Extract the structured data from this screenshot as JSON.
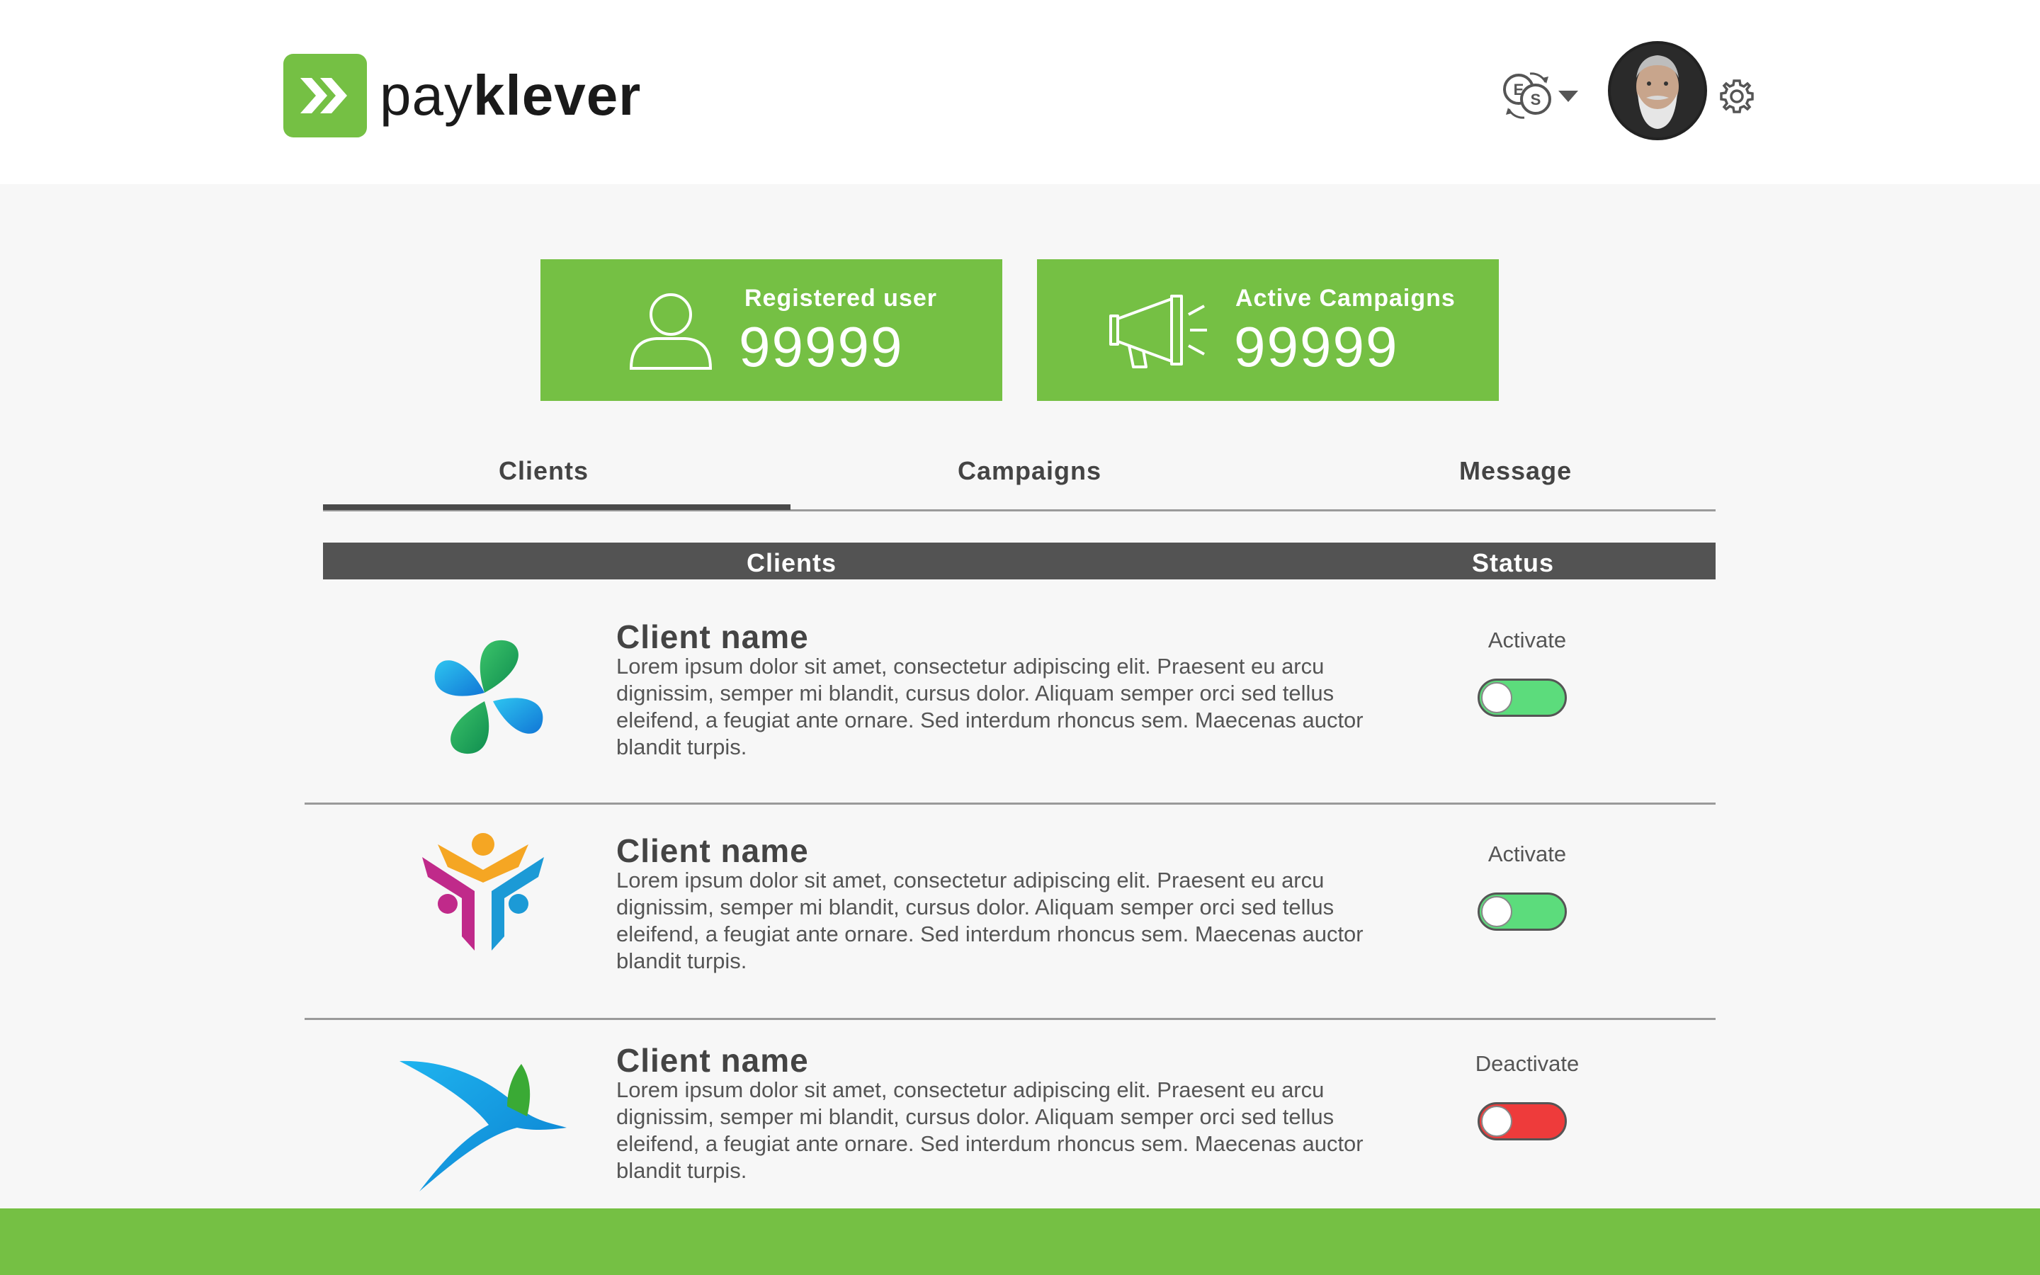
{
  "brand": {
    "name_light": "pay",
    "name_bold": "klever",
    "color": "#75c044"
  },
  "header": {
    "currency_icon": "currency-exchange-icon",
    "avatar_alt": "user avatar",
    "settings_icon": "gear-icon"
  },
  "stats": [
    {
      "label": "Registered user",
      "value": "99999",
      "icon": "user-icon"
    },
    {
      "label": "Active Campaigns",
      "value": "99999",
      "icon": "megaphone-icon"
    }
  ],
  "tabs": [
    {
      "label": "Clients",
      "active": true
    },
    {
      "label": "Campaigns",
      "active": false
    },
    {
      "label": "Message",
      "active": false
    }
  ],
  "table": {
    "headers": {
      "clients": "Clients",
      "status": "Status"
    },
    "rows": [
      {
        "name": "Client name",
        "description": "Lorem ipsum dolor sit amet, consectetur adipiscing elit. Praesent eu arcu dignissim, semper mi blandit, cursus dolor. Aliquam semper orci sed tellus eleifend, a feugiat ante ornare. Sed interdum rhoncus sem. Maecenas auctor blandit turpis.",
        "status": "Activate",
        "toggle": "on"
      },
      {
        "name": "Client name",
        "description": "Lorem ipsum dolor sit amet, consectetur adipiscing elit. Praesent eu arcu dignissim, semper mi blandit, cursus dolor. Aliquam semper orci sed tellus eleifend, a feugiat ante ornare. Sed interdum rhoncus sem. Maecenas auctor blandit turpis.",
        "status": "Activate",
        "toggle": "on"
      },
      {
        "name": "Client name",
        "description": "Lorem ipsum dolor sit amet, consectetur adipiscing elit. Praesent eu arcu dignissim, semper mi blandit, cursus dolor. Aliquam semper orci sed tellus eleifend, a feugiat ante ornare. Sed interdum rhoncus sem. Maecenas auctor blandit turpis.",
        "status": "Deactivate",
        "toggle": "off"
      }
    ]
  },
  "colors": {
    "accent": "#75c044",
    "table_header": "#535353",
    "toggle_on": "#5cdc7c",
    "toggle_off": "#ee3b3b"
  }
}
